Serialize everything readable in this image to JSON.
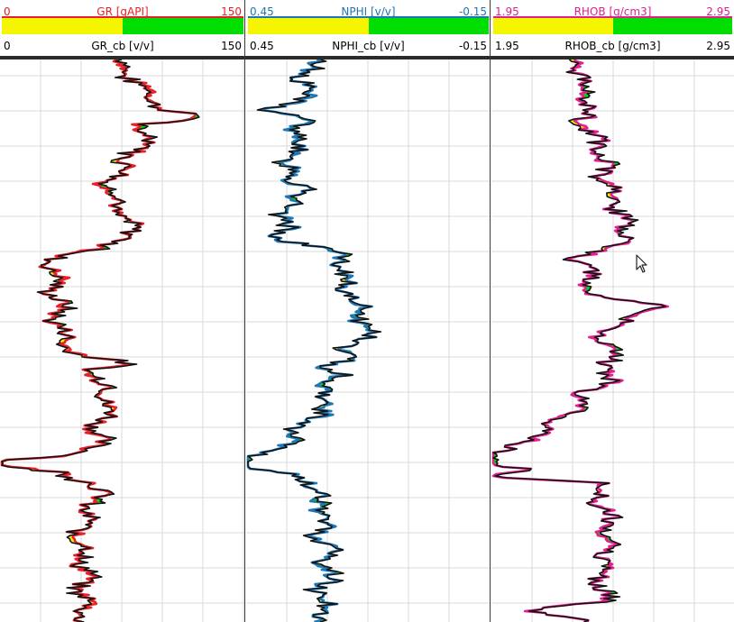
{
  "tracks": [
    {
      "id": "gr",
      "curve1": {
        "label": "GR [gAPI]",
        "left": "0",
        "right": "150",
        "color": "#e8202a"
      },
      "curve2": {
        "label": "GR_cb [v/v]",
        "left": "0",
        "right": "150",
        "color": "#000000"
      },
      "fill_colors": {
        "low": "#f5f500",
        "high": "#00dd00"
      }
    },
    {
      "id": "nphi",
      "curve1": {
        "label": "NPHI [v/v]",
        "left": "0.45",
        "right": "-0.15",
        "color": "#1e77b4"
      },
      "curve2": {
        "label": "NPHI_cb [v/v]",
        "left": "0.45",
        "right": "-0.15",
        "color": "#000000"
      },
      "fill_colors": {
        "low": "#f5f500",
        "high": "#00dd00"
      }
    },
    {
      "id": "rhob",
      "curve1": {
        "label": "RHOB [g/cm3]",
        "left": "1.95",
        "right": "2.95",
        "color": "#e0208c"
      },
      "curve2": {
        "label": "RHOB_cb [g/cm3]",
        "left": "1.95",
        "right": "2.95",
        "color": "#000000"
      },
      "fill_colors": {
        "low": "#f5f500",
        "high": "#00dd00"
      }
    }
  ],
  "icons": {
    "cursor": "mouse-pointer-icon"
  }
}
